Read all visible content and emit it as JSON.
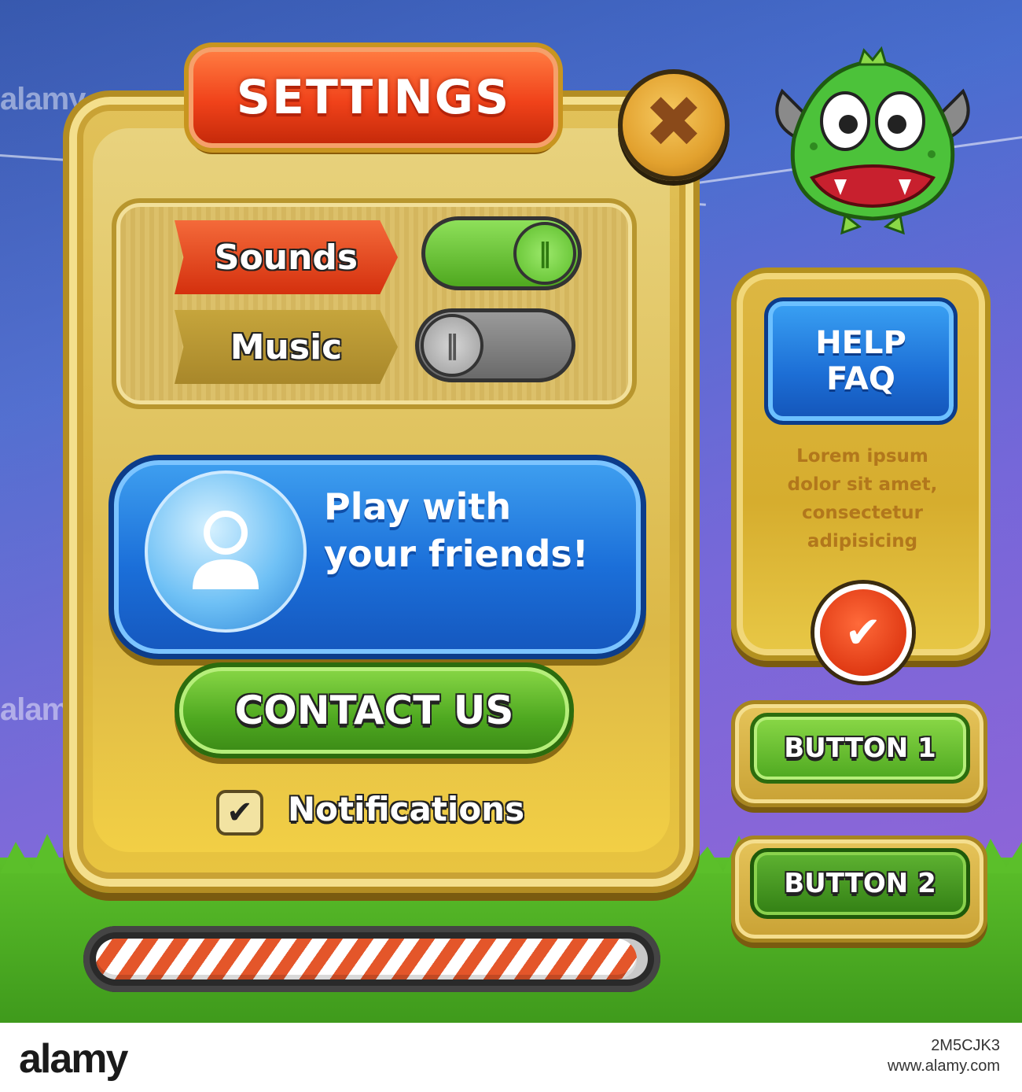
{
  "settings": {
    "title": "SETTINGS",
    "close_icon": "close-x-icon",
    "toggles": [
      {
        "label": "Sounds",
        "state": "on"
      },
      {
        "label": "Music",
        "state": "off"
      }
    ],
    "friends_button": {
      "line1": "Play with",
      "line2": "your friends!",
      "icon": "user-icon"
    },
    "contact_button": "CONTACT US",
    "notifications": {
      "label": "Notifications",
      "checked": true
    }
  },
  "progress": {
    "value": 0.98
  },
  "help": {
    "button_line1": "HELP",
    "button_line2": "FAQ",
    "body_lines": [
      "Lorem ipsum",
      "dolor sit amet,",
      "consectetur",
      "adipisicing"
    ],
    "ok_icon": "checkmark-icon"
  },
  "buttons": {
    "button1": "BUTTON 1",
    "button2": "BUTTON 2"
  },
  "watermark": {
    "text": "alamy"
  },
  "footer": {
    "logo": "alamy",
    "image_id": "2M5CJK3",
    "site": "www.alamy.com"
  },
  "colors": {
    "accent_red": "#f0421a",
    "accent_blue": "#1b6fd9",
    "accent_green": "#4ea820",
    "panel_gold": "#d4ae3a"
  }
}
